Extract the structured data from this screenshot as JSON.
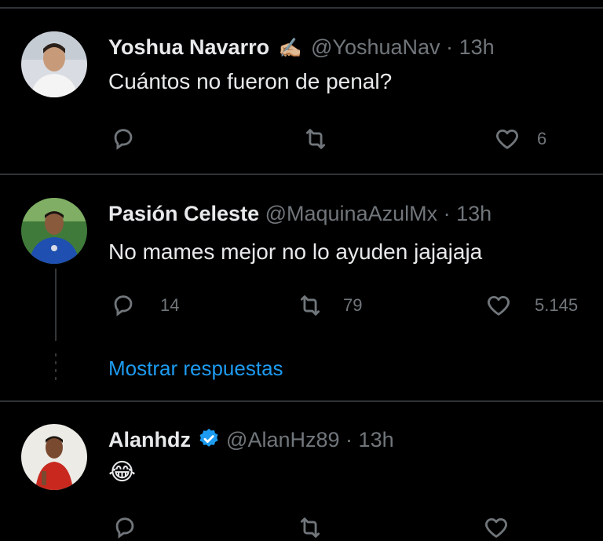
{
  "tweets": [
    {
      "name": "Yoshua Navarro",
      "badge_emoji": "✍🏼",
      "handle": "@YoshuaNav",
      "separator": "·",
      "time": "13h",
      "text": "Cuántos no fueron de penal?",
      "reply_count": "",
      "retweet_count": "",
      "like_count": "6"
    },
    {
      "name": "Pasión Celeste",
      "handle": "@MaquinaAzulMx",
      "separator": "·",
      "time": "13h",
      "text": "No mames mejor no lo ayuden jajajaja",
      "reply_count": "14",
      "retweet_count": "79",
      "like_count": "5.145"
    },
    {
      "name": "Alanhdz",
      "handle": "@AlanHz89",
      "separator": "·",
      "time": "13h",
      "text": "😂"
    }
  ],
  "show_replies_label": "Mostrar respuestas",
  "colors": {
    "background": "#000000",
    "text": "#e7e9ea",
    "muted": "#71767b",
    "link": "#1d9bf0",
    "verified": "#1d9bf0",
    "divider": "#2f3336"
  },
  "icons": [
    "reply-icon",
    "retweet-icon",
    "like-icon",
    "verified-badge-icon"
  ]
}
